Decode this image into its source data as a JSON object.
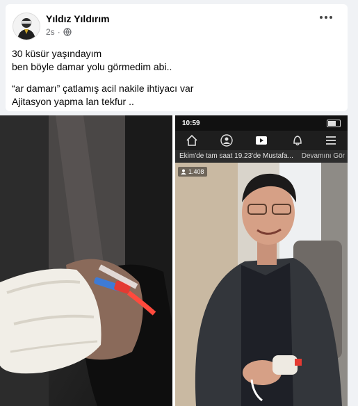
{
  "post": {
    "author": "Yıldız Yıldırım",
    "time": "2s",
    "privacy_icon": "globe-icon",
    "menu_icon": "more-horizontal-icon",
    "lines": [
      "30 küsür yaşındayım",
      "ben böyle damar yolu görmedim abi..",
      "“ar damarı” çatlamış acil nakile ihtiyacı var",
      "Ajitasyon yapma lan tekfur .."
    ]
  },
  "phone": {
    "time": "10:59",
    "nav_icons": [
      "home-icon",
      "friends-icon",
      "video-icon",
      "bell-icon",
      "menu-icon"
    ],
    "ticker_text": "Ekim'de tam saat 19.23'de Mustafa...",
    "ticker_more": "Devamını Gör",
    "viewers": "1.408"
  },
  "colors": {
    "page_bg": "#f0f2f5",
    "card_bg": "#ffffff",
    "text": "#050505",
    "meta": "#65676b"
  }
}
